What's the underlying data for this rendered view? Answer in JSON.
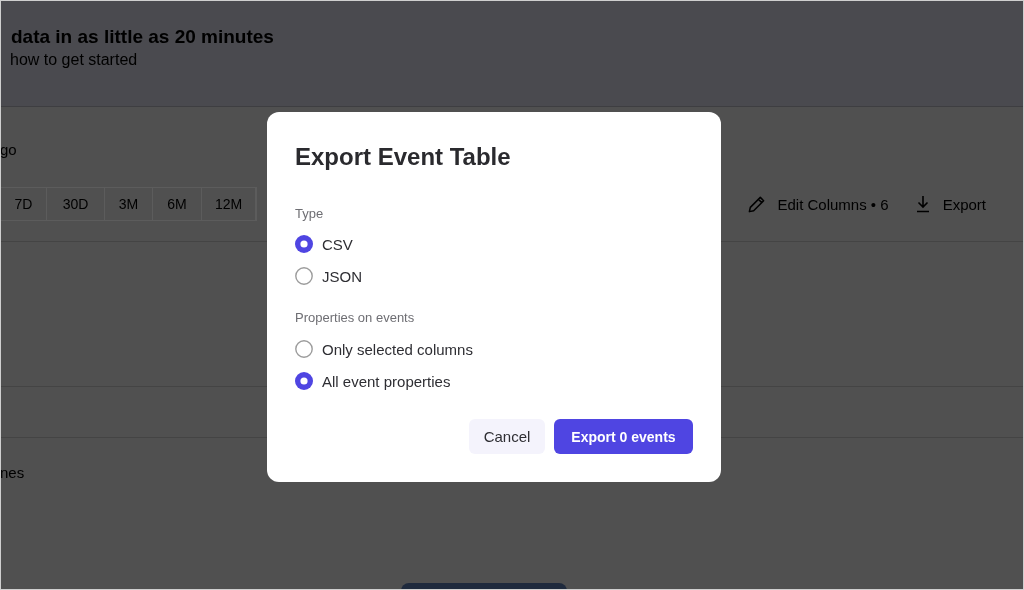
{
  "banner": {
    "title": "data in as little as 20 minutes",
    "subtitle": "how to get started"
  },
  "page": {
    "caption": "go",
    "time_ranges": [
      {
        "label": "7D"
      },
      {
        "label": "30D"
      },
      {
        "label": "3M"
      },
      {
        "label": "6M"
      },
      {
        "label": "12M"
      }
    ],
    "toolbar": [
      {
        "label": "Edit Columns • 6",
        "kind": "edit"
      },
      {
        "label": "Export",
        "kind": "export"
      }
    ],
    "footer_text": "nes"
  },
  "dialog": {
    "title": "Export Event Table",
    "groups": [
      {
        "label": "Type",
        "options": [
          {
            "label": "CSV",
            "selected": true
          },
          {
            "label": "JSON",
            "selected": false
          }
        ]
      },
      {
        "label": "Properties on events",
        "options": [
          {
            "label": "Only selected columns",
            "selected": false
          },
          {
            "label": "All event properties",
            "selected": true
          }
        ]
      }
    ],
    "buttons": [
      {
        "label": "Cancel",
        "kind": "secondary"
      },
      {
        "label": "Export 0 events",
        "kind": "primary"
      }
    ]
  }
}
